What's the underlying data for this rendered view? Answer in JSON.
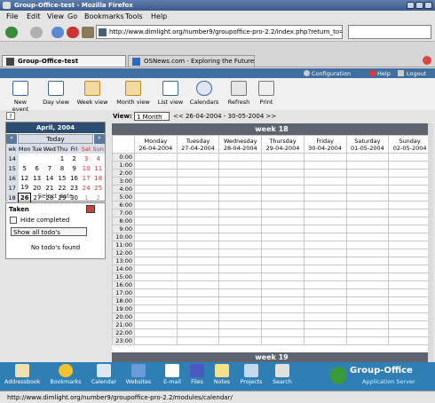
{
  "window": {
    "title": "Group-Office-test - Mozilla Firefox"
  },
  "menu": [
    "File",
    "Edit",
    "View",
    "Go",
    "Bookmarks",
    "Tools",
    "Help"
  ],
  "address": {
    "url": "http://www.dimlight.org/number9/groupoffice-pro-2.2/index.php?return_to=%2"
  },
  "tabs": [
    {
      "label": "Group-Office-test"
    },
    {
      "label": "OSNews.com - Exploring the Future..."
    }
  ],
  "go_header": {
    "configuration": "Configuration",
    "help": "Help",
    "logout": "Logout"
  },
  "toolbar": [
    "New event",
    "Day view",
    "Week view",
    "Month view",
    "List view",
    "Calendars",
    "Refresh",
    "Print"
  ],
  "minical": {
    "month": "April, 2004",
    "today": "Today",
    "select_date": "Select date",
    "help_mark": "?",
    "days": [
      "wk",
      "Mon",
      "Tue",
      "Wed",
      "Thu",
      "Fri",
      "Sat",
      "Sun"
    ],
    "rows": [
      [
        "14",
        "",
        "",
        "",
        "1",
        "2",
        "3",
        "4"
      ],
      [
        "15",
        "5",
        "6",
        "7",
        "8",
        "9",
        "10",
        "11"
      ],
      [
        "16",
        "12",
        "13",
        "14",
        "15",
        "16",
        "17",
        "18"
      ],
      [
        "17",
        "19",
        "20",
        "21",
        "22",
        "23",
        "24",
        "25"
      ],
      [
        "18",
        "26",
        "27",
        "28",
        "29",
        "30",
        "1",
        "2"
      ]
    ]
  },
  "todo": {
    "title": "Taken",
    "hide": "Hide completed",
    "filter": "Show all todo's",
    "none": "No todo's found"
  },
  "view": {
    "label": "View:",
    "selected": "1 Month",
    "range": "<< 26-04-2004 - 30-05-2004 >>"
  },
  "week18": {
    "title": "week 18",
    "days": [
      {
        "name": "Monday",
        "date": "26-04-2004"
      },
      {
        "name": "Tuesday",
        "date": "27-04-2004"
      },
      {
        "name": "Wednesday",
        "date": "28-04-2004"
      },
      {
        "name": "Thursday",
        "date": "29-04-2004"
      },
      {
        "name": "Friday",
        "date": "30-04-2004"
      },
      {
        "name": "Saturday",
        "date": "01-05-2004"
      },
      {
        "name": "Sunday",
        "date": "02-05-2004"
      }
    ],
    "hours": [
      "0:00",
      "1:00",
      "2:00",
      "3:00",
      "4:00",
      "5:00",
      "6:00",
      "7:00",
      "8:00",
      "9:00",
      "10:00",
      "11:00",
      "12:00",
      "13:00",
      "14:00",
      "15:00",
      "16:00",
      "17:00",
      "18:00",
      "19:00",
      "20:00",
      "21:00",
      "22:00",
      "23:00"
    ]
  },
  "week19": {
    "title": "week 19"
  },
  "bottom": [
    "Addressbook",
    "Bookmarks",
    "Calendar",
    "Websites",
    "E-mail",
    "Files",
    "Notes",
    "Projects",
    "Search"
  ],
  "logo": {
    "name": "Group-Office",
    "sub": "Application Server"
  },
  "status": "http://www.dimlight.org/number9/groupoffice-pro-2.2/modules/calendar/"
}
